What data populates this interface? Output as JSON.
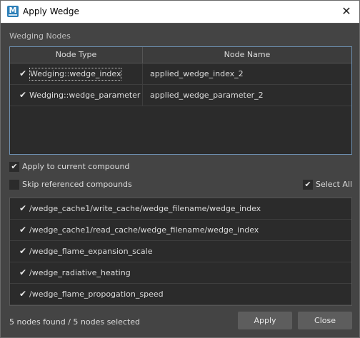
{
  "window": {
    "title": "Apply Wedge",
    "app_icon_letter": "M"
  },
  "nodes_section": {
    "label": "Wedging Nodes",
    "columns": [
      "Node Type",
      "Node Name"
    ],
    "rows": [
      {
        "checked": true,
        "type": "Wedging::wedge_index",
        "name": "applied_wedge_index_2"
      },
      {
        "checked": true,
        "type": "Wedging::wedge_parameter",
        "name": "applied_wedge_parameter_2"
      }
    ]
  },
  "options": {
    "apply_current": {
      "label": "Apply to current compound",
      "checked": true
    },
    "skip_referenced": {
      "label": "Skip referenced compounds",
      "checked": false
    },
    "select_all": {
      "label": "Select All",
      "checked": true
    }
  },
  "paths": [
    {
      "checked": true,
      "path": "/wedge_cache1/write_cache/wedge_filename/wedge_index"
    },
    {
      "checked": true,
      "path": "/wedge_cache1/read_cache/wedge_filename/wedge_index"
    },
    {
      "checked": true,
      "path": "/wedge_flame_expansion_scale"
    },
    {
      "checked": true,
      "path": "/wedge_radiative_heating"
    },
    {
      "checked": true,
      "path": "/wedge_flame_propogation_speed"
    }
  ],
  "status": "5 nodes found / 5 nodes selected",
  "buttons": {
    "apply": "Apply",
    "close": "Close"
  },
  "icons": {
    "check": "checkmark-icon",
    "close": "close-icon"
  },
  "colors": {
    "background": "#444444",
    "list_bg": "#2b2b2b",
    "accent_border": "#6d8fb0",
    "button": "#5d5d5d"
  }
}
